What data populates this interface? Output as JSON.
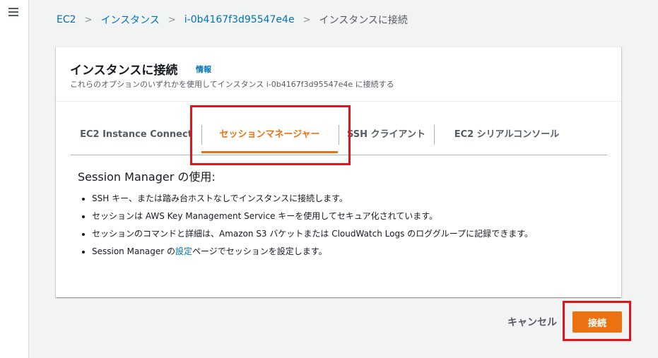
{
  "nav": {
    "menu_icon": "hamburger-menu-icon"
  },
  "breadcrumb": {
    "items": [
      "EC2",
      "インスタンス",
      "i-0b4167f3d95547e4e"
    ],
    "current": "インスタンスに接続",
    "separator": ">"
  },
  "panel": {
    "title": "インスタンスに接続",
    "info_link": "情報",
    "description": "これらのオプションのいずれかを使用してインスタンス i-0b4167f3d95547e4e に接続する"
  },
  "tabs": [
    {
      "label": "EC2 Instance Connect",
      "active": false
    },
    {
      "label": "セッションマネージャー",
      "active": true
    },
    {
      "label": "SSH クライアント",
      "active": false
    },
    {
      "label": "EC2 シリアルコンソール",
      "active": false
    }
  ],
  "content": {
    "heading": "Session Manager の使用:",
    "bullets": [
      "SSH キー、または踏み台ホストなしでインスタンスに接続します。",
      "セッションは AWS Key Management Service キーを使用してセキュア化されています。",
      "セッションのコマンドと詳細は、Amazon S3 バケットまたは CloudWatch Logs のロググループに記録できます。"
    ],
    "last_bullet": {
      "prefix": "Session Manager の",
      "link": "設定",
      "suffix": "ページでセッションを設定します。"
    }
  },
  "actions": {
    "cancel": "キャンセル",
    "connect": "接続"
  },
  "colors": {
    "accent": "#ec7211",
    "link": "#0073bb",
    "highlight": "#e0141c"
  }
}
